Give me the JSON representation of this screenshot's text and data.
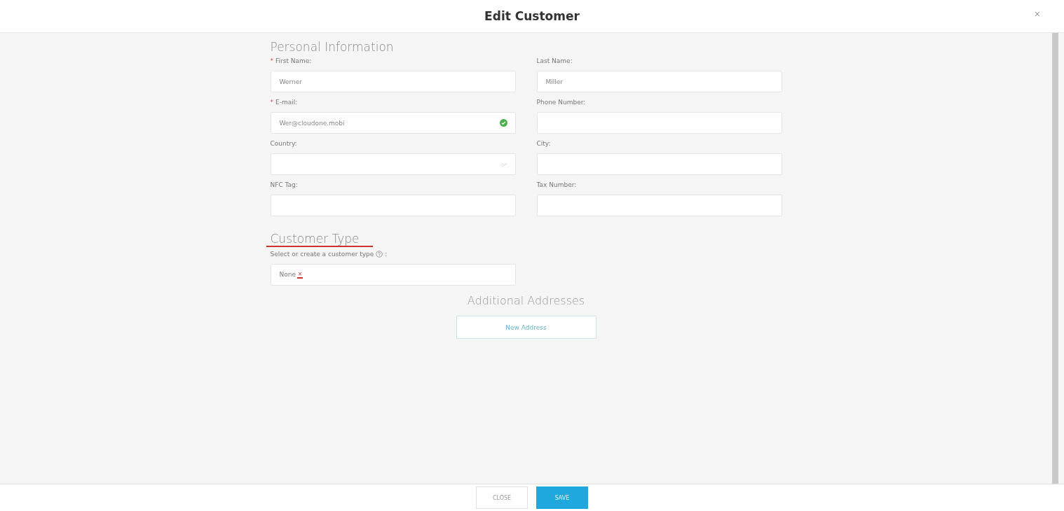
{
  "dialog": {
    "title": "Edit Customer",
    "close_glyph": "×"
  },
  "personal": {
    "required_glyph": "*",
    "heading": "Personal Information",
    "fields": [
      {
        "kind": "text",
        "label": "First Name:",
        "required": true,
        "value": "Werner",
        "valid": false
      },
      {
        "kind": "text",
        "label": "Last Name:",
        "required": false,
        "value": "Miller",
        "valid": false
      },
      {
        "kind": "text",
        "label": "E-mail:",
        "required": true,
        "value": "Wer@cloudone.mobi",
        "valid": true
      },
      {
        "kind": "text",
        "label": "Phone Number:",
        "required": false,
        "valid": false
      },
      {
        "kind": "select",
        "label": "Country:",
        "required": false,
        "valid": false
      },
      {
        "kind": "text",
        "label": "City:",
        "required": false,
        "valid": false
      },
      {
        "kind": "text",
        "label": "NFC Tag:",
        "required": false,
        "valid": false
      },
      {
        "kind": "text",
        "label": "Tax Number:",
        "required": false,
        "valid": false
      }
    ]
  },
  "customer_type": {
    "heading": "Customer Type",
    "label": "Select or create a customer type",
    "label_suffix": ":",
    "tags": [
      {
        "label": "None",
        "remove_glyph": "×"
      }
    ]
  },
  "addresses": {
    "heading": "Additional Addresses",
    "button": "New Address"
  },
  "footer": {
    "buttons": [
      {
        "label": "CLOSE",
        "kind": "secondary"
      },
      {
        "label": "SAVE",
        "kind": "primary"
      }
    ]
  }
}
